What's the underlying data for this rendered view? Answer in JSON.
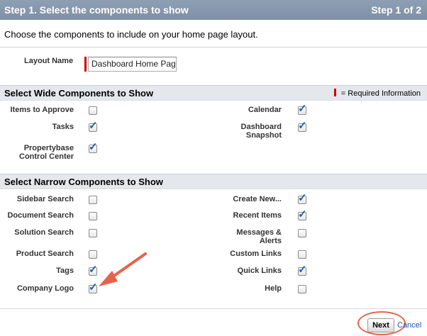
{
  "header": {
    "title": "Step 1. Select the components to show",
    "step": "Step 1 of 2"
  },
  "intro": "Choose the components to include on your home page layout.",
  "layout": {
    "label": "Layout Name",
    "value": "Dashboard Home Page"
  },
  "wide": {
    "title": "Select Wide Components to Show",
    "required_legend": "= Required Information",
    "items": [
      {
        "label": "Items to Approve",
        "checked": false
      },
      {
        "label": "Calendar",
        "checked": true
      },
      {
        "label": "Tasks",
        "checked": true
      },
      {
        "label": "Dashboard Snapshot",
        "checked": true
      },
      {
        "label": "Propertybase Control Center",
        "checked": true
      }
    ]
  },
  "narrow": {
    "title": "Select Narrow Components to Show",
    "items": [
      {
        "label": "Sidebar Search",
        "checked": false
      },
      {
        "label": "Create New...",
        "checked": true
      },
      {
        "label": "Document Search",
        "checked": false
      },
      {
        "label": "Recent Items",
        "checked": true
      },
      {
        "label": "Solution Search",
        "checked": false
      },
      {
        "label": "Messages & Alerts",
        "checked": false
      },
      {
        "label": "Product Search",
        "checked": false
      },
      {
        "label": "Custom Links",
        "checked": false
      },
      {
        "label": "Tags",
        "checked": true
      },
      {
        "label": "Quick Links",
        "checked": true
      },
      {
        "label": "Company Logo",
        "checked": true
      },
      {
        "label": "Help",
        "checked": false
      }
    ]
  },
  "buttons": {
    "next": "Next",
    "cancel": "Cancel"
  },
  "colors": {
    "header": "#8a9bb0",
    "section": "#e4e8ec",
    "required": "#cc0000",
    "annotation": "#e8624a",
    "check": "#1b5fa8",
    "link": "#1a55b5"
  }
}
